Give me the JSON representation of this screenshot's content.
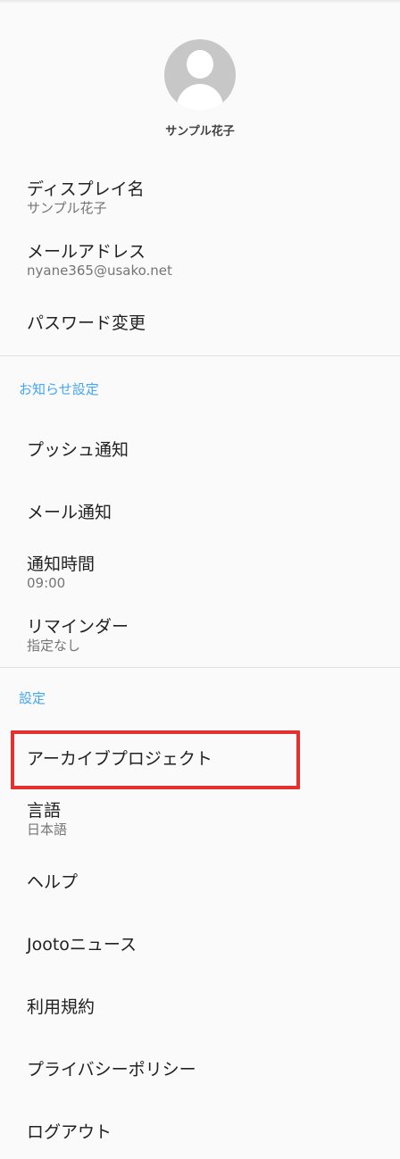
{
  "profile": {
    "name": "サンプル花子",
    "avatar_icon": "user-avatar-icon"
  },
  "account": {
    "display_name": {
      "label": "ディスプレイ名",
      "value": "サンプル花子"
    },
    "email": {
      "label": "メールアドレス",
      "value": "nyane365@usako.net"
    },
    "password_label": "パスワード変更"
  },
  "notifications": {
    "header": "お知らせ設定",
    "push_label": "プッシュ通知",
    "mail_label": "メール通知",
    "time": {
      "label": "通知時間",
      "value": "09:00"
    },
    "reminder": {
      "label": "リマインダー",
      "value": "指定なし"
    }
  },
  "settings": {
    "header": "設定",
    "archive_label": "アーカイブプロジェクト",
    "language": {
      "label": "言語",
      "value": "日本語"
    },
    "help_label": "ヘルプ",
    "news_label": "Jootoニュース",
    "terms_label": "利用規約",
    "privacy_label": "プライバシーポリシー",
    "logout_label": "ログアウト"
  },
  "colors": {
    "accent": "#42a5f5",
    "highlight": "#e53030",
    "background": "#fafafa"
  }
}
